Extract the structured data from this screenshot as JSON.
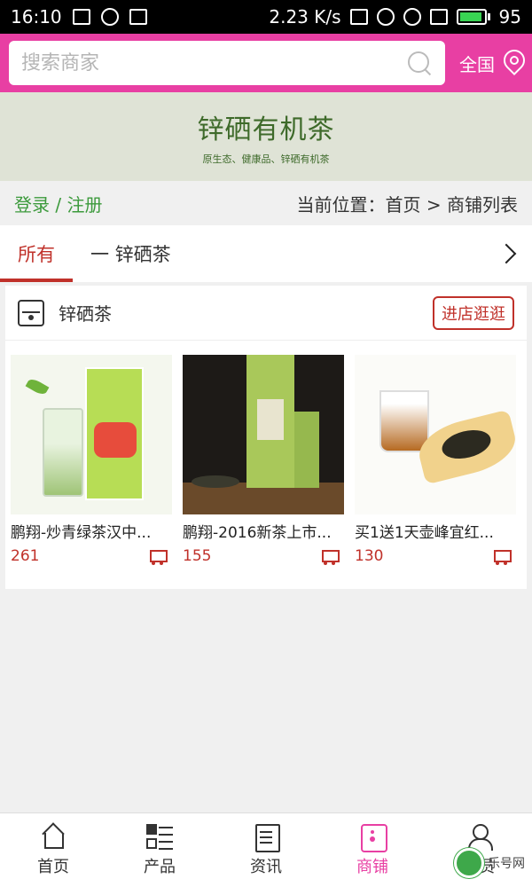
{
  "status_bar": {
    "time": "16:10",
    "speed": "2.23 K/s",
    "battery": "95",
    "battery_level": 0.95
  },
  "search": {
    "placeholder": "搜索商家",
    "region_label": "全国"
  },
  "banner": {
    "title": "锌硒有机茶",
    "subtitle": "原生态、健康品、锌硒有机茶"
  },
  "location_bar": {
    "login_label": "登录 / 注册",
    "breadcrumb": "当前位置：首页 > 商铺列表"
  },
  "tabs": [
    {
      "label": "所有",
      "active": true
    },
    {
      "label": "一 锌硒茶",
      "active": false
    }
  ],
  "shop": {
    "name": "锌硒茶",
    "enter_label": "进店逛逛",
    "products": [
      {
        "title": "鹏翔-炒青绿茶汉中...",
        "price": "261"
      },
      {
        "title": "鹏翔-2016新茶上市...",
        "price": "155"
      },
      {
        "title": "买1送1天壶峰宜红...",
        "price": "130"
      }
    ]
  },
  "bottom_nav": [
    {
      "label": "首页",
      "icon": "home-icon"
    },
    {
      "label": "产品",
      "icon": "grid-icon"
    },
    {
      "label": "资讯",
      "icon": "news-icon"
    },
    {
      "label": "商铺",
      "icon": "shop-icon",
      "active": true
    },
    {
      "label": "会员",
      "icon": "user-icon"
    }
  ],
  "watermark": {
    "text": "乐号网"
  },
  "colors": {
    "accent": "#e83fa3",
    "price_red": "#c0312a",
    "login_green": "#3c9a3c"
  }
}
